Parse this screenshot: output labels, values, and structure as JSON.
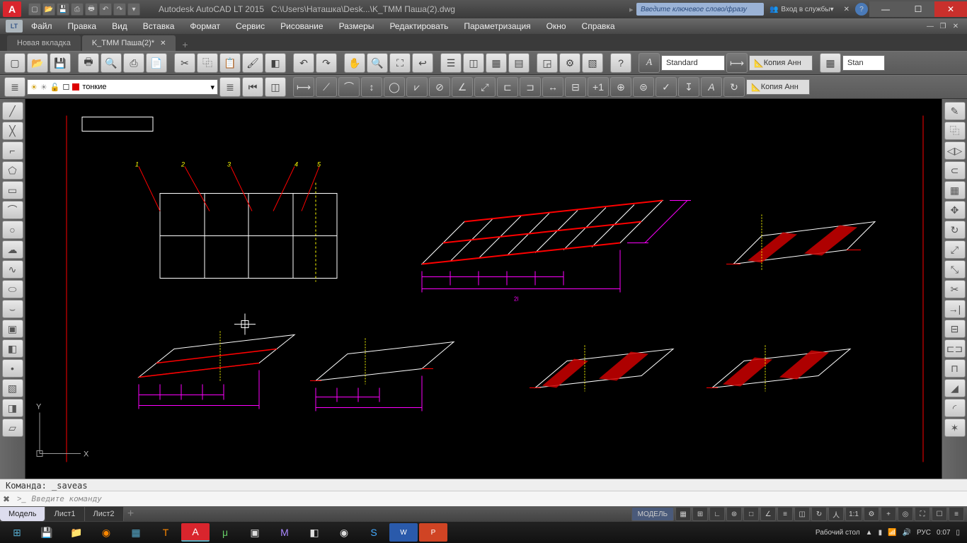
{
  "titlebar": {
    "app_name": "Autodesk AutoCAD LT 2015",
    "file_path": "C:\\Users\\Наташка\\Desk...\\K_TMM Паша(2).dwg",
    "logo_letter": "A",
    "search_placeholder": "Введите ключевое слово/фразу",
    "signin": "Вход в службы",
    "help": "?"
  },
  "menu": {
    "lt": "LT",
    "items": [
      "Файл",
      "Правка",
      "Вид",
      "Вставка",
      "Формат",
      "Сервис",
      "Рисование",
      "Размеры",
      "Редактировать",
      "Параметризация",
      "Окно",
      "Справка"
    ]
  },
  "doctabs": {
    "tabs": [
      {
        "label": "Новая вкладка"
      },
      {
        "label": "K_TMM Паша(2)*"
      }
    ],
    "plus": "+"
  },
  "toolbar1": {
    "text_style": "Standard",
    "annotation": "Копия Анн",
    "stan_label": "Stan"
  },
  "toolbar2": {
    "layer_name": "тонкие",
    "annotation2": "Копия Анн",
    "plus1": "+1"
  },
  "cmdline": {
    "history": "Команда: _saveas",
    "placeholder": "Введите команду",
    "chevron": ">_"
  },
  "layout": {
    "tabs": [
      "Модель",
      "Лист1",
      "Лист2"
    ],
    "plus": "+"
  },
  "statusbar": {
    "model": "МОДЕЛЬ",
    "scale": "1:1"
  },
  "taskbar": {
    "desktop_label": "Рабочий стол",
    "lang": "РУС",
    "time": "0:07"
  },
  "drawing": {
    "top_labels": [
      "1",
      "2",
      "3",
      "4",
      "5"
    ]
  }
}
